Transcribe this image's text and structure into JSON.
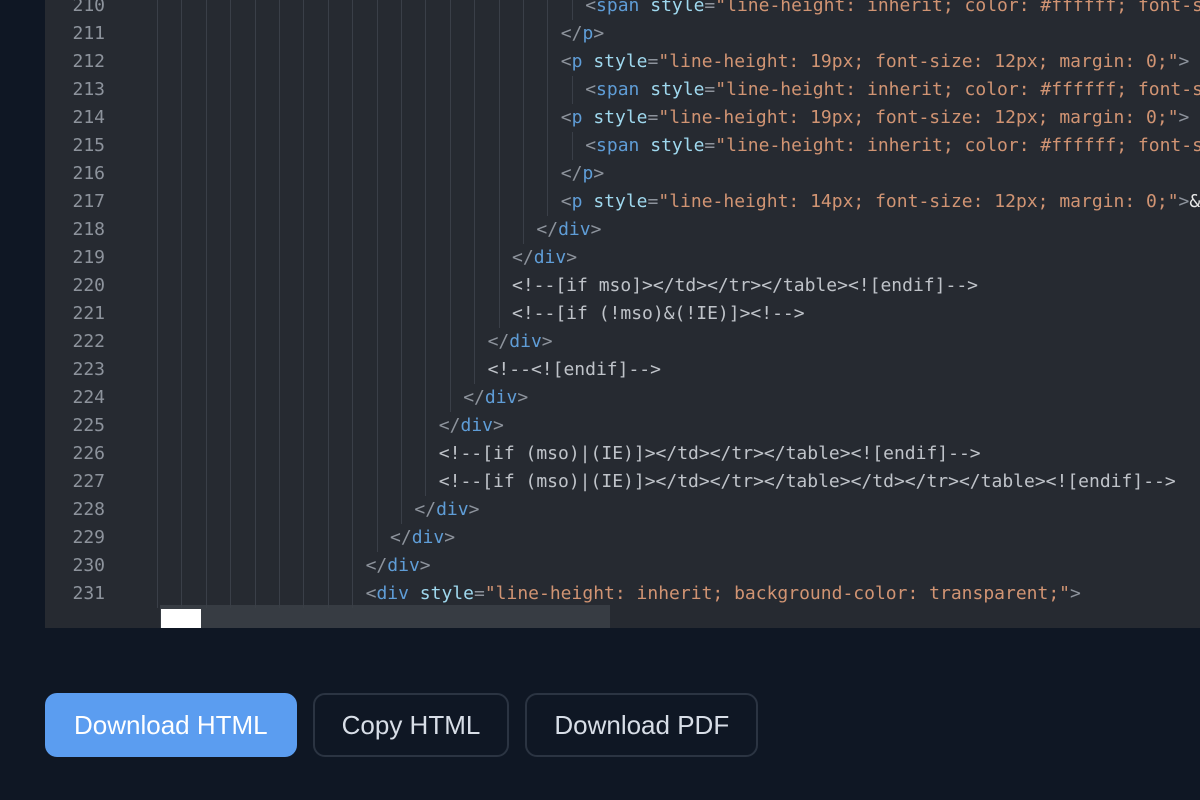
{
  "editor": {
    "lines": [
      {
        "n": "210",
        "indent": 18,
        "tokens": [
          {
            "t": "<",
            "c": "punct"
          },
          {
            "t": "span",
            "c": "tag"
          },
          {
            "t": " ",
            "c": "punct"
          },
          {
            "t": "style",
            "c": "attr"
          },
          {
            "t": "=",
            "c": "punct"
          },
          {
            "t": "\"line-height: inherit; color: #ffffff; font-siz",
            "c": "str"
          }
        ]
      },
      {
        "n": "211",
        "indent": 17,
        "tokens": [
          {
            "t": "</",
            "c": "punct"
          },
          {
            "t": "p",
            "c": "tag"
          },
          {
            "t": ">",
            "c": "punct"
          }
        ]
      },
      {
        "n": "212",
        "indent": 17,
        "tokens": [
          {
            "t": "<",
            "c": "punct"
          },
          {
            "t": "p",
            "c": "tag"
          },
          {
            "t": " ",
            "c": "punct"
          },
          {
            "t": "style",
            "c": "attr"
          },
          {
            "t": "=",
            "c": "punct"
          },
          {
            "t": "\"line-height: 19px; font-size: 12px; margin: 0;\"",
            "c": "str"
          },
          {
            "t": ">",
            "c": "punct"
          }
        ]
      },
      {
        "n": "213",
        "indent": 18,
        "tokens": [
          {
            "t": "<",
            "c": "punct"
          },
          {
            "t": "span",
            "c": "tag"
          },
          {
            "t": " ",
            "c": "punct"
          },
          {
            "t": "style",
            "c": "attr"
          },
          {
            "t": "=",
            "c": "punct"
          },
          {
            "t": "\"line-height: inherit; color: #ffffff; font-siz",
            "c": "str"
          }
        ]
      },
      {
        "n": "214",
        "indent": 17,
        "tokens": [
          {
            "t": "<",
            "c": "punct"
          },
          {
            "t": "p",
            "c": "tag"
          },
          {
            "t": " ",
            "c": "punct"
          },
          {
            "t": "style",
            "c": "attr"
          },
          {
            "t": "=",
            "c": "punct"
          },
          {
            "t": "\"line-height: 19px; font-size: 12px; margin: 0;\"",
            "c": "str"
          },
          {
            "t": ">",
            "c": "punct"
          }
        ]
      },
      {
        "n": "215",
        "indent": 18,
        "tokens": [
          {
            "t": "<",
            "c": "punct"
          },
          {
            "t": "span",
            "c": "tag"
          },
          {
            "t": " ",
            "c": "punct"
          },
          {
            "t": "style",
            "c": "attr"
          },
          {
            "t": "=",
            "c": "punct"
          },
          {
            "t": "\"line-height: inherit; color: #ffffff; font-siz",
            "c": "str"
          }
        ]
      },
      {
        "n": "216",
        "indent": 17,
        "tokens": [
          {
            "t": "</",
            "c": "punct"
          },
          {
            "t": "p",
            "c": "tag"
          },
          {
            "t": ">",
            "c": "punct"
          }
        ]
      },
      {
        "n": "217",
        "indent": 17,
        "tokens": [
          {
            "t": "<",
            "c": "punct"
          },
          {
            "t": "p",
            "c": "tag"
          },
          {
            "t": " ",
            "c": "punct"
          },
          {
            "t": "style",
            "c": "attr"
          },
          {
            "t": "=",
            "c": "punct"
          },
          {
            "t": "\"line-height: 14px; font-size: 12px; margin: 0;\"",
            "c": "str"
          },
          {
            "t": ">",
            "c": "punct"
          },
          {
            "t": "&nb",
            "c": "ent"
          }
        ]
      },
      {
        "n": "218",
        "indent": 16,
        "tokens": [
          {
            "t": "</",
            "c": "punct"
          },
          {
            "t": "div",
            "c": "tag"
          },
          {
            "t": ">",
            "c": "punct"
          }
        ]
      },
      {
        "n": "219",
        "indent": 15,
        "tokens": [
          {
            "t": "</",
            "c": "punct"
          },
          {
            "t": "div",
            "c": "tag"
          },
          {
            "t": ">",
            "c": "punct"
          }
        ]
      },
      {
        "n": "220",
        "indent": 15,
        "tokens": [
          {
            "t": "<!--[if mso]></td></tr></table><![endif]-->",
            "c": "comment"
          }
        ]
      },
      {
        "n": "221",
        "indent": 15,
        "tokens": [
          {
            "t": "<!--[if (!mso)&(!IE)]><!-->",
            "c": "comment"
          }
        ]
      },
      {
        "n": "222",
        "indent": 14,
        "tokens": [
          {
            "t": "</",
            "c": "punct"
          },
          {
            "t": "div",
            "c": "tag"
          },
          {
            "t": ">",
            "c": "punct"
          }
        ]
      },
      {
        "n": "223",
        "indent": 14,
        "tokens": [
          {
            "t": "<!--<![endif]-->",
            "c": "comment"
          }
        ]
      },
      {
        "n": "224",
        "indent": 13,
        "tokens": [
          {
            "t": "</",
            "c": "punct"
          },
          {
            "t": "div",
            "c": "tag"
          },
          {
            "t": ">",
            "c": "punct"
          }
        ]
      },
      {
        "n": "225",
        "indent": 12,
        "tokens": [
          {
            "t": "</",
            "c": "punct"
          },
          {
            "t": "div",
            "c": "tag"
          },
          {
            "t": ">",
            "c": "punct"
          }
        ]
      },
      {
        "n": "226",
        "indent": 12,
        "tokens": [
          {
            "t": "<!--[if (mso)|(IE)]></td></tr></table><![endif]-->",
            "c": "comment"
          }
        ]
      },
      {
        "n": "227",
        "indent": 12,
        "tokens": [
          {
            "t": "<!--[if (mso)|(IE)]></td></tr></table></td></tr></table><![endif]-->",
            "c": "comment"
          }
        ]
      },
      {
        "n": "228",
        "indent": 11,
        "tokens": [
          {
            "t": "</",
            "c": "punct"
          },
          {
            "t": "div",
            "c": "tag"
          },
          {
            "t": ">",
            "c": "punct"
          }
        ]
      },
      {
        "n": "229",
        "indent": 10,
        "tokens": [
          {
            "t": "</",
            "c": "punct"
          },
          {
            "t": "div",
            "c": "tag"
          },
          {
            "t": ">",
            "c": "punct"
          }
        ]
      },
      {
        "n": "230",
        "indent": 9,
        "tokens": [
          {
            "t": "</",
            "c": "punct"
          },
          {
            "t": "div",
            "c": "tag"
          },
          {
            "t": ">",
            "c": "punct"
          }
        ]
      },
      {
        "n": "231",
        "indent": 9,
        "tokens": [
          {
            "t": "<",
            "c": "punct"
          },
          {
            "t": "div",
            "c": "tag"
          },
          {
            "t": " ",
            "c": "punct"
          },
          {
            "t": "style",
            "c": "attr"
          },
          {
            "t": "=",
            "c": "punct"
          },
          {
            "t": "\"line-height: inherit; background-color: transparent;\"",
            "c": "str"
          },
          {
            "t": ">",
            "c": "punct"
          }
        ]
      }
    ]
  },
  "actions": {
    "download_html": "Download HTML",
    "copy_html": "Copy HTML",
    "download_pdf": "Download PDF"
  },
  "colors": {
    "accent": "#5b9df0",
    "editor_bg": "#262a31",
    "page_bg": "#0f1724"
  }
}
